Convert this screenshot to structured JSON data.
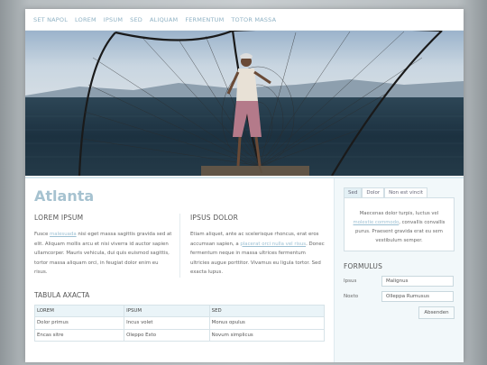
{
  "nav": [
    "SET NAPOL",
    "LOREM",
    "IPSUM",
    "SED",
    "ALIQUAM",
    "FERMENTUM",
    "TOTOR MASSA"
  ],
  "page_title": "Atlanta",
  "col1": {
    "heading": "LOREM IPSUM",
    "text_a": "Fusce ",
    "link": "malesuada",
    "text_b": " nisi eget massa sagittis gravida sed at elit. Aliquam mollis arcu et nisi viverra id auctor sapien ullamcorper. Mauris vehicula, dui quis euismod sagittis, tortor massa aliquam orci, in feugiat dolor enim eu risus."
  },
  "col2": {
    "heading": "IPSUS DOLOR",
    "text_a": "Etiam aliquet, ante ac scelerisque rhoncus, erat eros accumsan sapien, a ",
    "link": "placerat orci nulla vel risus",
    "text_b": ". Donec fermentum neque in massa ultrices fermentum ultricies augue porttitor. Vivamus eu ligula tortor. Sed exacta lupus."
  },
  "table": {
    "title": "TABULA AXACTA",
    "headers": [
      "LOREM",
      "IPSUM",
      "SED"
    ],
    "rows": [
      [
        "Dolor primus",
        "Incus volet",
        "Monus opulus"
      ],
      [
        "Encas sitre",
        "Oleppo Exto",
        "Novum simplicus"
      ]
    ]
  },
  "side": {
    "tabs": [
      "Sed",
      "Dolor",
      "Non est vincit"
    ],
    "tab_text_a": "Maecenas dolor turpis, luctus vel ",
    "tab_link": "molestie commodo",
    "tab_text_b": ", convallis convallis purus. Praesent gravida erat eu sem vestibulum semper.",
    "form_heading": "FORMULUS",
    "fields": [
      {
        "label": "Ipsus",
        "value": "Malignus"
      },
      {
        "label": "Noxto",
        "value": "Olleppa Rumusus"
      }
    ],
    "button": "Absenden"
  },
  "colors": {
    "accent": "#a6c2d0",
    "link": "#9cc0d3",
    "sidebar_bg": "#f2f8fa"
  }
}
